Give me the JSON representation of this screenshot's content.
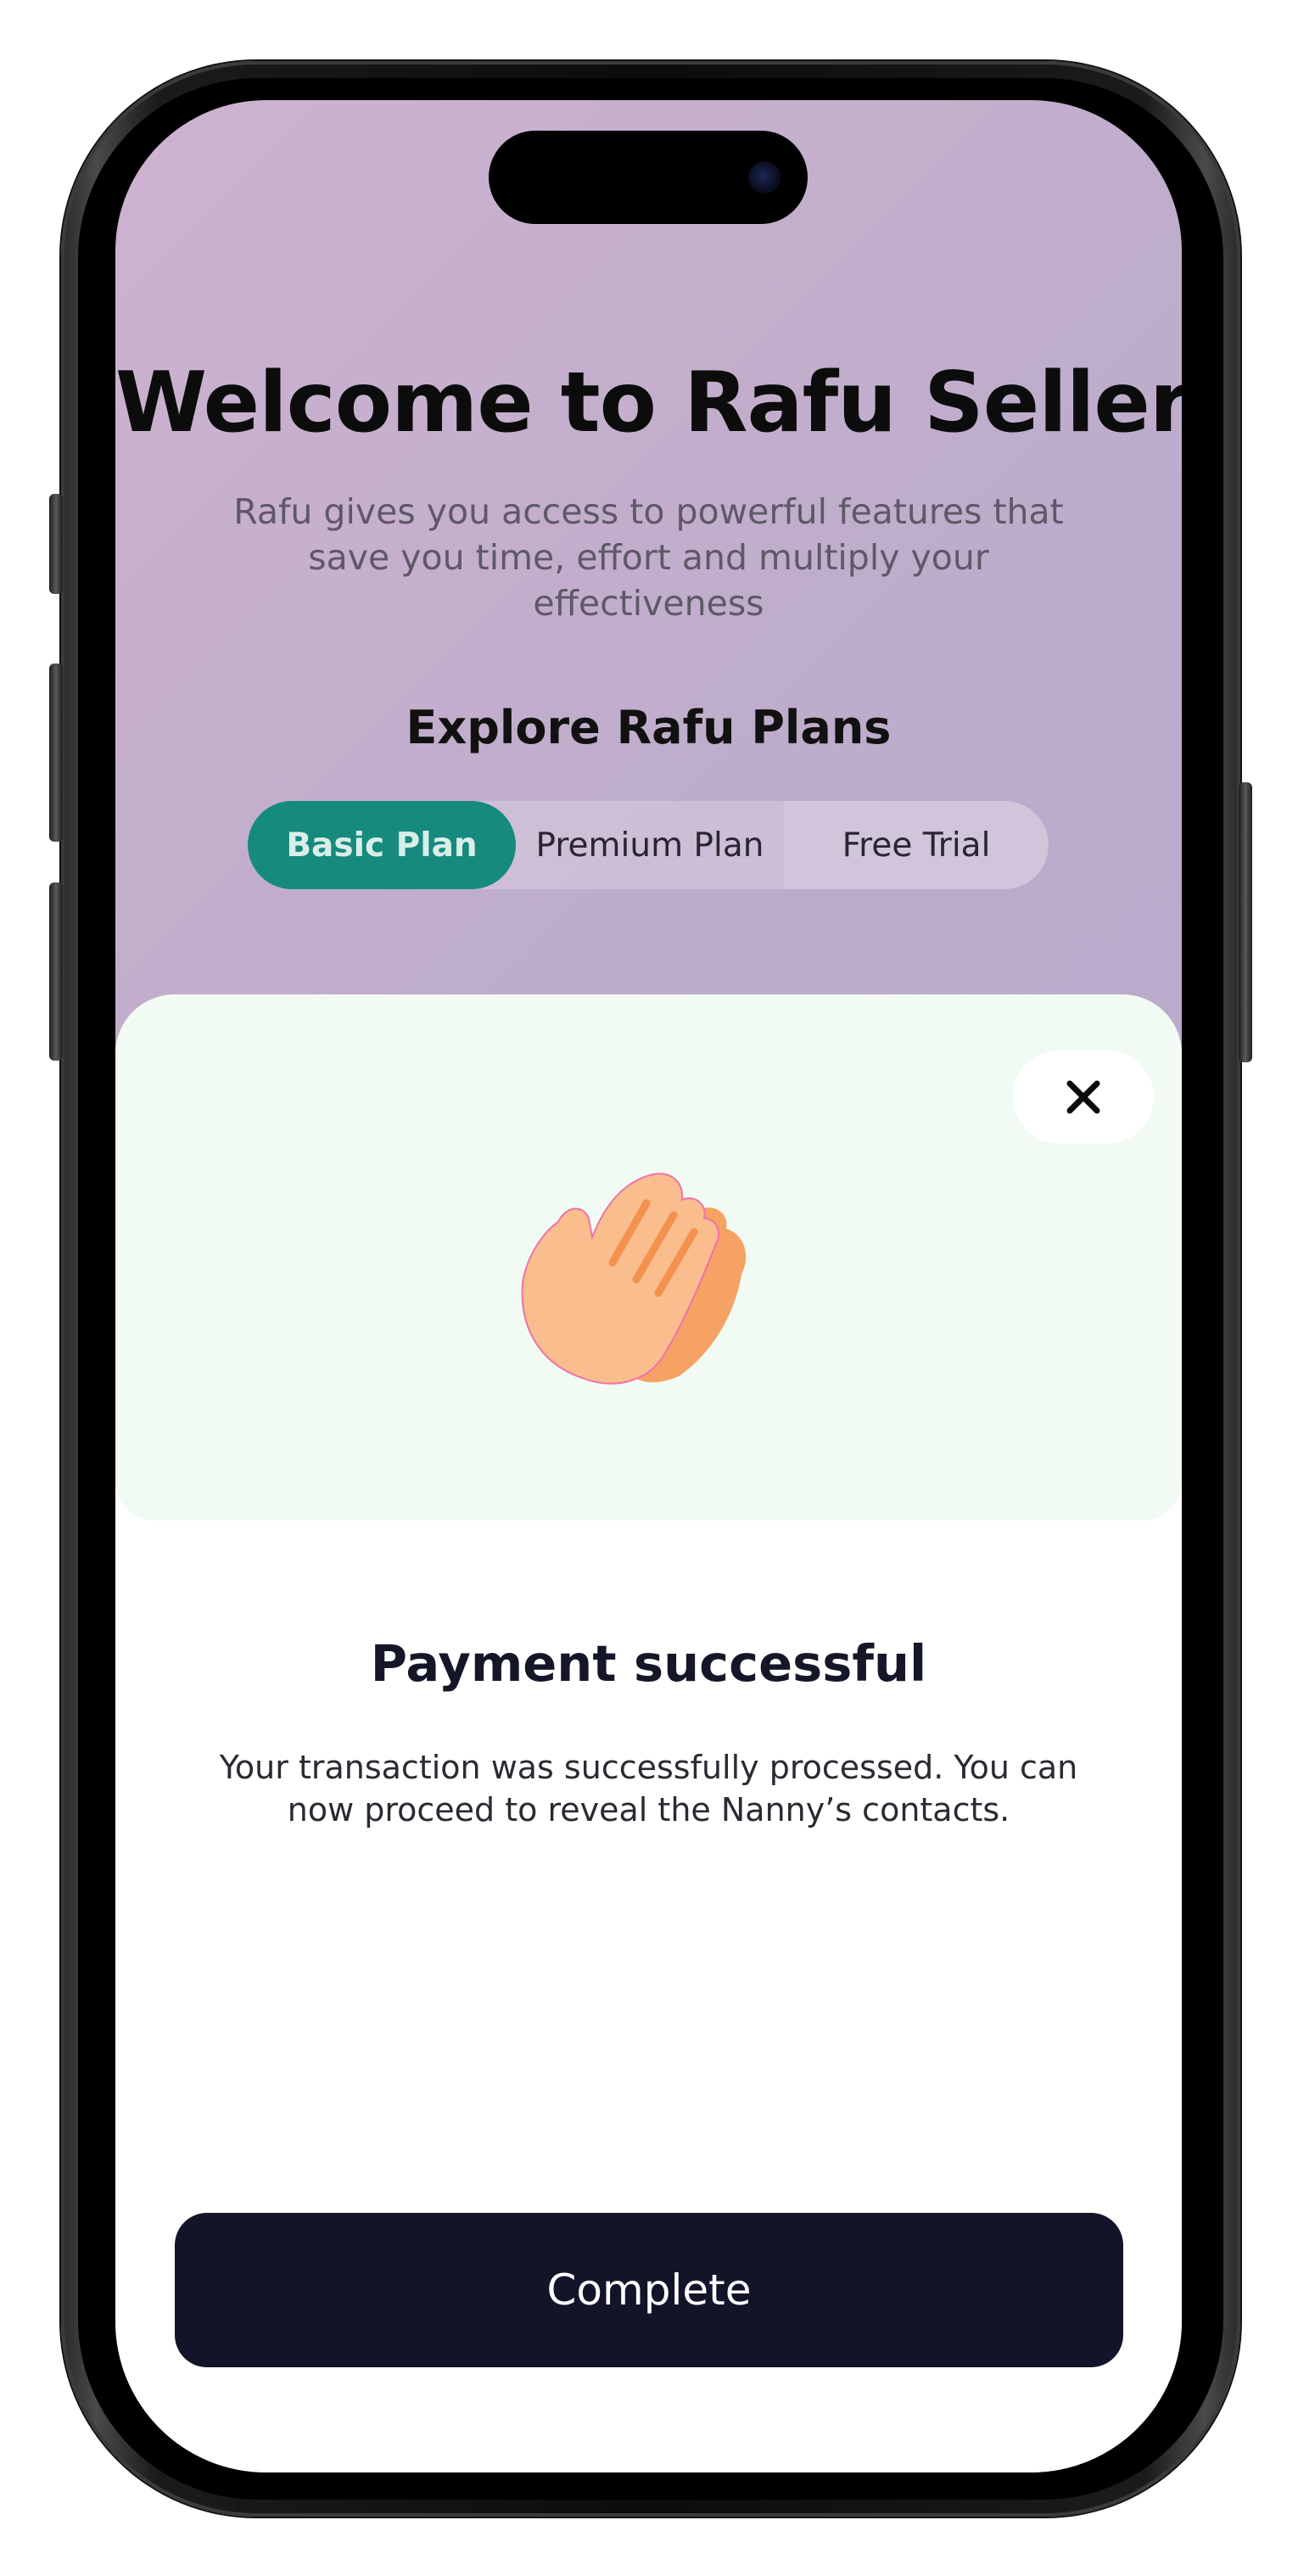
{
  "header": {
    "title": "Welcome to Rafu Sellers",
    "subtitle": "Rafu gives you access to powerful features that save you time, effort and multiply your effectiveness"
  },
  "plans": {
    "heading": "Explore Rafu Plans",
    "tabs": [
      {
        "label": "Basic Plan",
        "selected": true
      },
      {
        "label": "Premium Plan",
        "selected": false
      },
      {
        "label": "Free Trial",
        "selected": false
      }
    ]
  },
  "sheet": {
    "close_icon": "close-icon",
    "illustration_icon": "clapping-hands-icon",
    "title": "Payment successful",
    "message": "Your transaction was successfully processed. You can now proceed to reveal the Nanny’s contacts.",
    "complete_label": "Complete"
  },
  "colors": {
    "accent_teal": "#178a7e",
    "primary_dark": "#13142a",
    "hero_background": "#f1fbf3",
    "gradient_start": "#cdb3cf",
    "gradient_end": "#b2a8cd"
  }
}
